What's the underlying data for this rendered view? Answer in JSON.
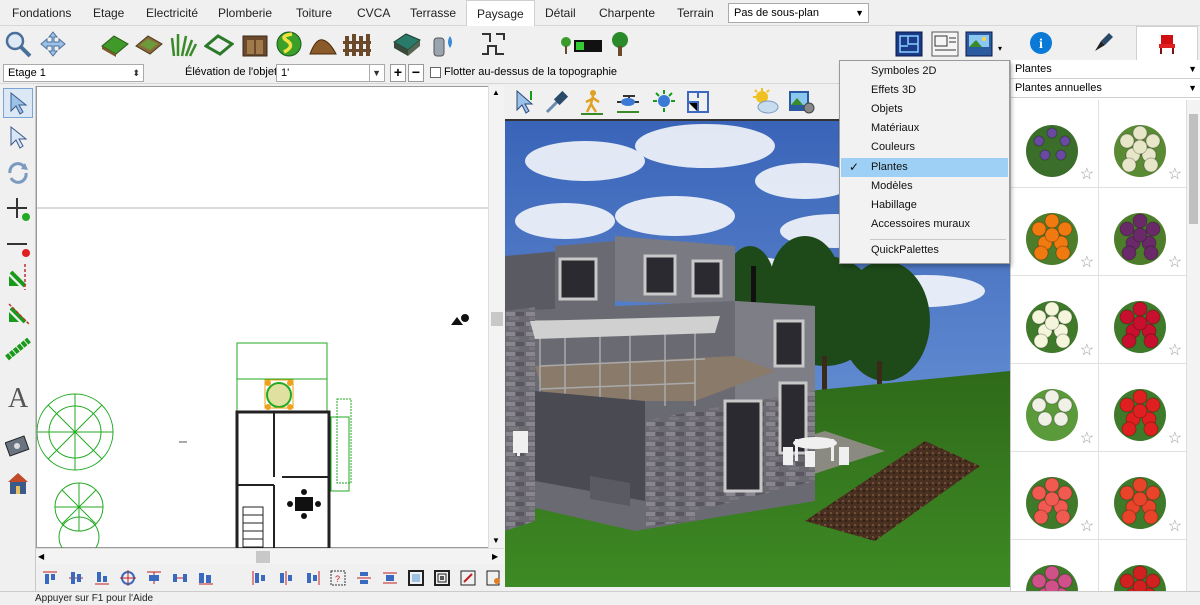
{
  "tabs": [
    {
      "label": "Fondations",
      "active": false
    },
    {
      "label": "Etage",
      "active": false
    },
    {
      "label": "Electricité",
      "active": false
    },
    {
      "label": "Plomberie",
      "active": false
    },
    {
      "label": "Toiture",
      "active": false
    },
    {
      "label": "CVCA",
      "active": false
    },
    {
      "label": "Terrasse",
      "active": false
    },
    {
      "label": "Paysage",
      "active": true
    },
    {
      "label": "Détail",
      "active": false
    },
    {
      "label": "Charpente",
      "active": false
    },
    {
      "label": "Terrain",
      "active": false
    }
  ],
  "subplan_select": {
    "value": "Pas de sous-plan"
  },
  "object_bar": {
    "floor_select": "Etage 1",
    "elevation_label": "Élévation de l'objet:",
    "elevation_value": "1'",
    "float_label": "Flotter au-dessus de la topographie",
    "float_checked": false
  },
  "library": {
    "category": "Plantes",
    "subcategory": "Plantes annuelles",
    "items": [
      {
        "icon": "lupine-plant-icon",
        "color": "#3b6e2a",
        "accent": "#6a4aa0"
      },
      {
        "icon": "white-flowering-plant-icon",
        "color": "#5b8a35",
        "accent": "#e8e6c8"
      },
      {
        "icon": "orange-marigold-icon",
        "color": "#4d7d2a",
        "accent": "#f07a10"
      },
      {
        "icon": "purple-pansy-icon",
        "color": "#4d7d2a",
        "accent": "#6a2a6a"
      },
      {
        "icon": "white-geranium-icon",
        "color": "#3f7a2a",
        "accent": "#f5f5dc"
      },
      {
        "icon": "red-begonia-icon",
        "color": "#3f7a2a",
        "accent": "#c8102e"
      },
      {
        "icon": "white-flower-stalk-icon",
        "color": "#5a9a3a",
        "accent": "#f0f0e6"
      },
      {
        "icon": "red-geranium-icon",
        "color": "#3f7a2a",
        "accent": "#e02020"
      },
      {
        "icon": "pink-impatiens-icon",
        "color": "#3f7a2a",
        "accent": "#f05a50"
      },
      {
        "icon": "coral-begonia-icon",
        "color": "#3f7a2a",
        "accent": "#e8442a"
      },
      {
        "icon": "pink-petunia-icon",
        "color": "#3f7a2a",
        "accent": "#d0508a"
      },
      {
        "icon": "red-flower-icon",
        "color": "#3f7a2a",
        "accent": "#d02020"
      }
    ]
  },
  "view_menu": {
    "items": [
      {
        "label": "Symboles 2D",
        "checked": false
      },
      {
        "label": "Effets 3D",
        "checked": false
      },
      {
        "label": "Objets",
        "checked": false
      },
      {
        "label": "Matériaux",
        "checked": false
      },
      {
        "label": "Couleurs",
        "checked": false
      },
      {
        "label": "Plantes",
        "checked": true
      },
      {
        "label": "Modèles",
        "checked": false
      },
      {
        "label": "Habillage",
        "checked": false
      },
      {
        "label": "Accessoires muraux",
        "checked": false
      }
    ],
    "extra": "QuickPalettes"
  },
  "status": "Appuyer sur F1 pour l'Aide",
  "colors": {
    "accent": "#0a7ad6",
    "menu_selected": "#9ed0f5",
    "plant_green": "#22aa22",
    "grass": "#3e7a24"
  }
}
